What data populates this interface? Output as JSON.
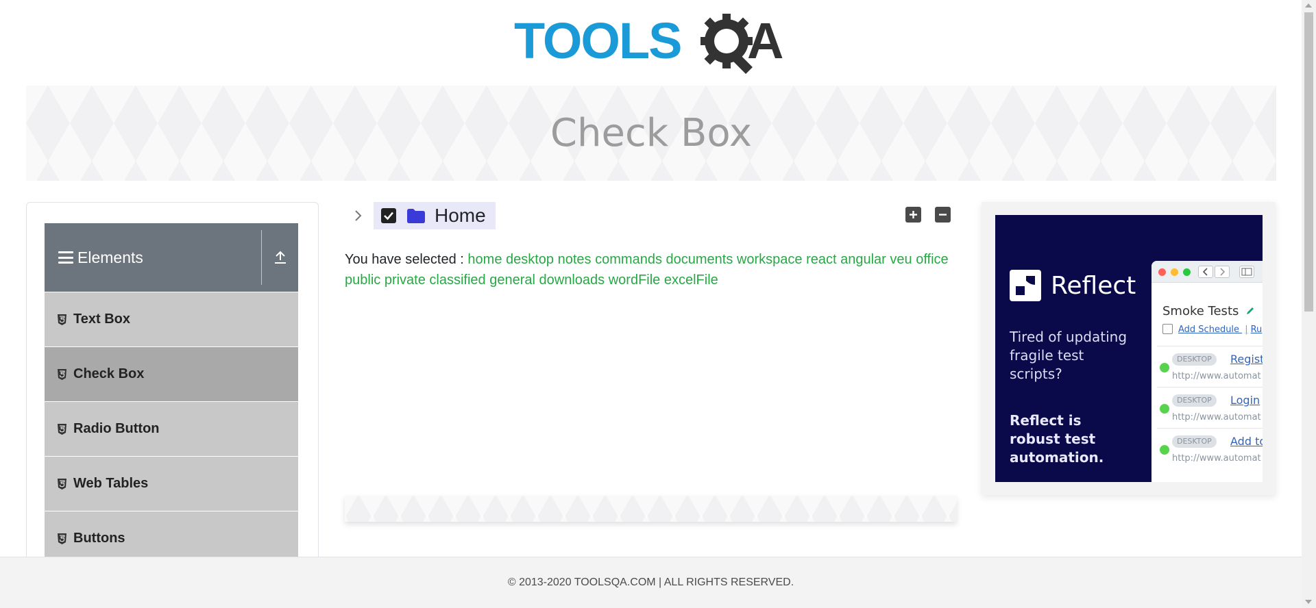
{
  "logo": {
    "text": "TOOLSQA",
    "icon": "gear-magnifier-icon"
  },
  "banner": {
    "title": "Check Box"
  },
  "sidebar": {
    "group_title": "Elements",
    "items": [
      {
        "label": "Text Box",
        "icon": "html5-icon",
        "active": false
      },
      {
        "label": "Check Box",
        "icon": "html5-icon",
        "active": true
      },
      {
        "label": "Radio Button",
        "icon": "html5-icon",
        "active": false
      },
      {
        "label": "Web Tables",
        "icon": "html5-icon",
        "active": false
      },
      {
        "label": "Buttons",
        "icon": "html5-icon",
        "active": false
      }
    ]
  },
  "tree": {
    "root_label": "Home",
    "checked": true,
    "expanded": false,
    "expand_all_icon": "plus-square-icon",
    "collapse_all_icon": "minus-square-icon"
  },
  "result": {
    "prefix": "You have selected :",
    "items": [
      "home",
      "desktop",
      "notes",
      "commands",
      "documents",
      "workspace",
      "react",
      "angular",
      "veu",
      "office",
      "public",
      "private",
      "classified",
      "general",
      "downloads",
      "wordFile",
      "excelFile"
    ]
  },
  "ad": {
    "brand": "Reflect",
    "tagline": "Tired of updating fragile test scripts?",
    "tagline2": "Reflect is robust test automation.",
    "window": {
      "title": "Smoke Tests",
      "link": "Add Schedule",
      "link_sep": "|",
      "link2": "Ru",
      "rows": [
        {
          "tag": "DESKTOP",
          "name": "Registr",
          "url": "http://www.automat"
        },
        {
          "tag": "DESKTOP",
          "name": "Login",
          "url": "http://www.automat"
        },
        {
          "tag": "DESKTOP",
          "name": "Add to",
          "url": "http://www.automat"
        }
      ]
    }
  },
  "footer": {
    "text": "© 2013-2020 TOOLSQA.COM | ALL RIGHTS RESERVED."
  },
  "colors": {
    "logo_blue": "#1a9bd7",
    "logo_dark": "#333333",
    "sidebar_header": "#6c757d",
    "menu_item": "#c8c8c8",
    "menu_item_active": "#a9a9a9",
    "success": "#28a745",
    "tree_highlight": "#e8e8f8",
    "ad_bg": "#0a0a4a"
  }
}
